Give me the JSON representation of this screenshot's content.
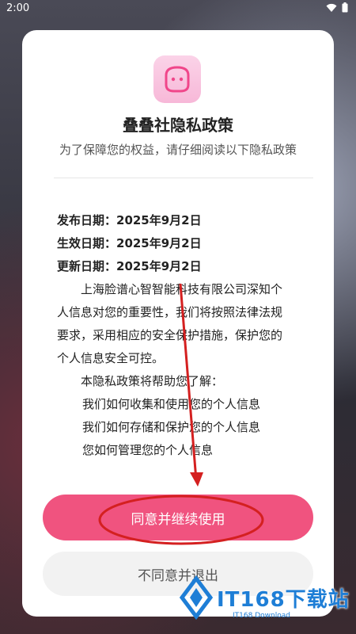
{
  "status_bar": {
    "time": "2:00",
    "wifi_icon": "wifi-icon",
    "battery_icon": "battery-icon"
  },
  "dialog": {
    "app_icon": "app-face-icon",
    "title": "叠叠社隐私政策",
    "subtitle": "为了保障您的权益，请仔细阅读以下隐私政策",
    "dates": [
      "发布日期：2025年9月2日",
      "生效日期：2025年9月2日",
      "更新日期：2025年9月2日"
    ],
    "paragraph_lines": [
      "上海脸谱心智智能科技有限公司深知个",
      "人信息对您的重要性，我们将按照法律法规",
      "要求，采用相应的安全保护措施，保护您的",
      "个人信息安全可控。"
    ],
    "intro": "本隐私政策将帮助您了解：",
    "items": [
      "我们如何收集和使用您的个人信息",
      "我们如何存储和保护您的个人信息",
      "您如何管理您的个人信息"
    ],
    "agree_label": "同意并继续使用",
    "disagree_label": "不同意并退出"
  },
  "watermark": {
    "text": "IT168下载站",
    "sub": "IT168 Download"
  },
  "colors": {
    "accent": "#f0537f",
    "annotation": "#d42020",
    "watermark": "#1e7ed6"
  }
}
